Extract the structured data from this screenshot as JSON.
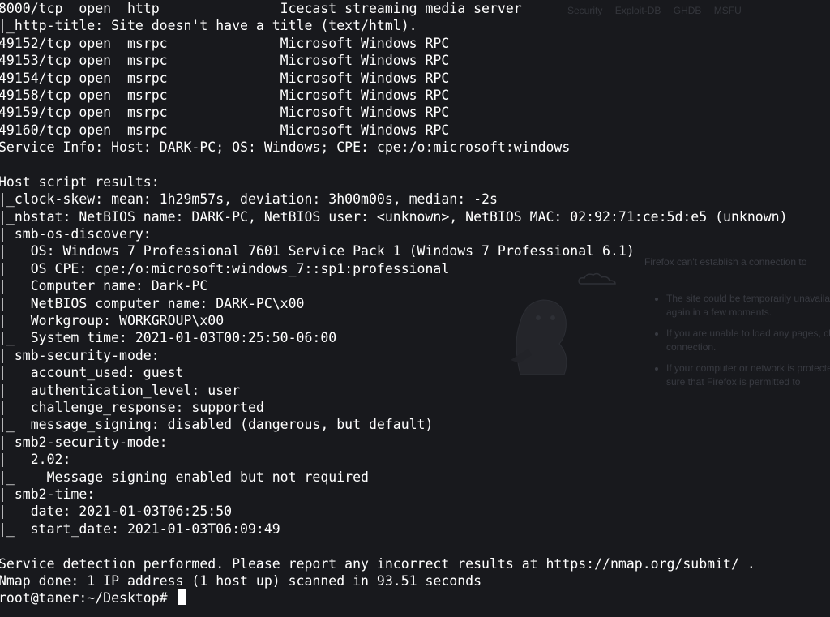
{
  "terminal": {
    "lines": [
      "8000/tcp  open  http               Icecast streaming media server",
      "|_http-title: Site doesn't have a title (text/html).",
      "49152/tcp open  msrpc              Microsoft Windows RPC",
      "49153/tcp open  msrpc              Microsoft Windows RPC",
      "49154/tcp open  msrpc              Microsoft Windows RPC",
      "49158/tcp open  msrpc              Microsoft Windows RPC",
      "49159/tcp open  msrpc              Microsoft Windows RPC",
      "49160/tcp open  msrpc              Microsoft Windows RPC",
      "Service Info: Host: DARK-PC; OS: Windows; CPE: cpe:/o:microsoft:windows",
      "",
      "Host script results:",
      "|_clock-skew: mean: 1h29m57s, deviation: 3h00m00s, median: -2s",
      "|_nbstat: NetBIOS name: DARK-PC, NetBIOS user: <unknown>, NetBIOS MAC: 02:92:71:ce:5d:e5 (unknown)",
      "| smb-os-discovery:",
      "|   OS: Windows 7 Professional 7601 Service Pack 1 (Windows 7 Professional 6.1)",
      "|   OS CPE: cpe:/o:microsoft:windows_7::sp1:professional",
      "|   Computer name: Dark-PC",
      "|   NetBIOS computer name: DARK-PC\\x00",
      "|   Workgroup: WORKGROUP\\x00",
      "|_  System time: 2021-01-03T00:25:50-06:00",
      "| smb-security-mode:",
      "|   account_used: guest",
      "|   authentication_level: user",
      "|   challenge_response: supported",
      "|_  message_signing: disabled (dangerous, but default)",
      "| smb2-security-mode:",
      "|   2.02:",
      "|_    Message signing enabled but not required",
      "| smb2-time:",
      "|   date: 2021-01-03T06:25:50",
      "|_  start_date: 2021-01-03T06:09:49",
      "",
      "Service detection performed. Please report any incorrect results at https://nmap.org/submit/ .",
      "Nmap done: 1 IP address (1 host up) scanned in 93.51 seconds"
    ],
    "prompt": "root@taner:~/Desktop# "
  },
  "background_browser": {
    "tabs": [
      "Security",
      "Exploit-DB",
      "GHDB",
      "MSFU"
    ],
    "error_title": "Firefox can't establish a connection to",
    "hints": [
      "The site could be temporarily unavailable, try again in a few moments.",
      "If you are unable to load any pages, check your connection.",
      "If your computer or network is protected, make sure that Firefox is permitted to"
    ]
  },
  "colors": {
    "background": "#18191d",
    "text": "#ffffff",
    "ghost": "#3a3c43"
  }
}
